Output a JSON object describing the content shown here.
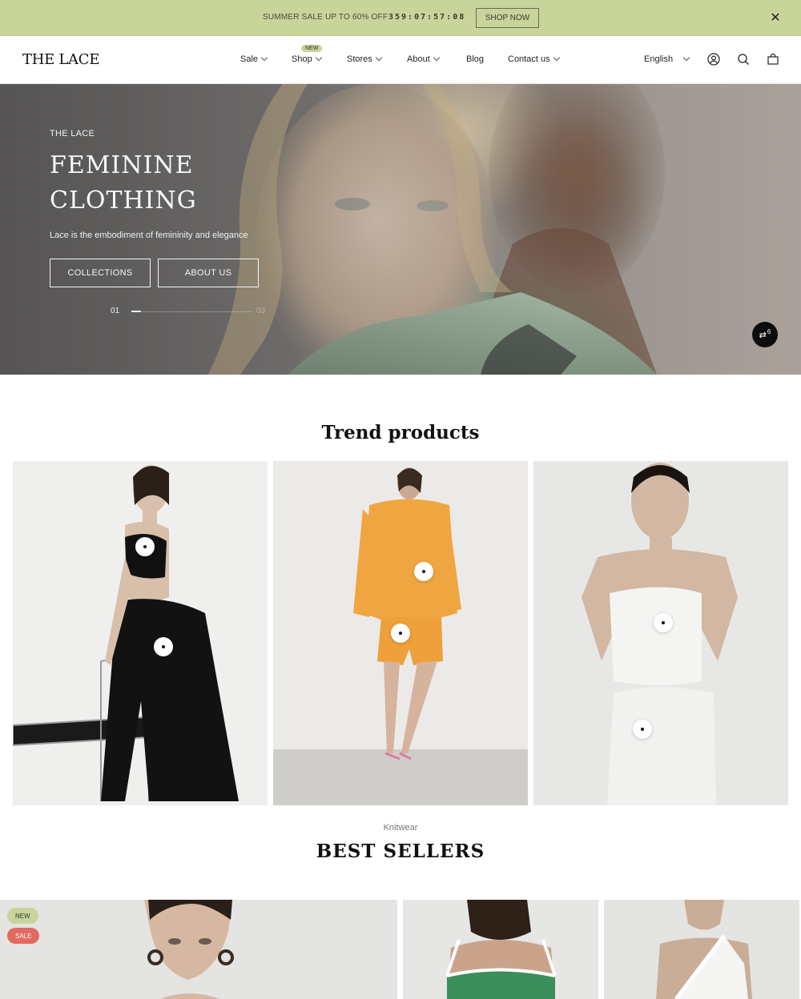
{
  "announcement": {
    "text": "SUMMER SALE UP TO 60% OFF",
    "countdown": "359:07:57:08",
    "cta": "SHOP NOW",
    "close_icon": "close-icon"
  },
  "header": {
    "logo": "THE LACE",
    "nav": [
      {
        "label": "Sale",
        "has_dropdown": true
      },
      {
        "label": "Shop",
        "has_dropdown": true,
        "badge": "NEW"
      },
      {
        "label": "Stores",
        "has_dropdown": true
      },
      {
        "label": "About",
        "has_dropdown": true
      },
      {
        "label": "Blog",
        "has_dropdown": false
      },
      {
        "label": "Contact us",
        "has_dropdown": true
      }
    ],
    "language": "English",
    "icons": [
      "account-icon",
      "search-icon",
      "cart-icon"
    ]
  },
  "hero": {
    "eyebrow": "THE LACE",
    "title": "FEMININE CLOTHING",
    "subtitle": "Lace is the embodiment of femininity and elegance",
    "buttons": [
      "COLLECTIONS",
      "ABOUT US"
    ],
    "slide_current": "01",
    "slide_total": "03",
    "slide_progress": 0.08,
    "compare_count": "6"
  },
  "trend": {
    "title": "Trend products"
  },
  "best_sellers": {
    "eyebrow": "Knitwear",
    "title": "BEST SELLERS",
    "badges": [
      "NEW",
      "SALE"
    ]
  },
  "colors": {
    "announcement_bg": "#c8d49a",
    "badge_new": "#c8d49a",
    "badge_sale": "#e06a5f"
  }
}
